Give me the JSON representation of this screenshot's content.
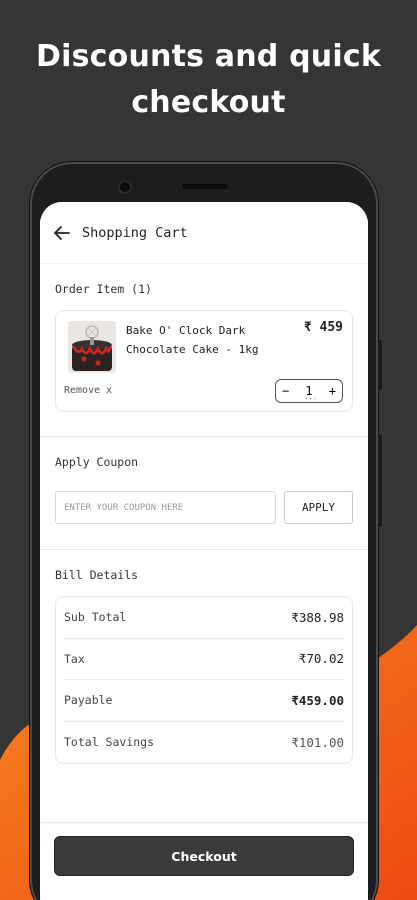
{
  "promo": {
    "headline_line1": "Discounts and quick",
    "headline_line2": "checkout"
  },
  "colors": {
    "background": "#353535",
    "accent_orange": "#f05a1a",
    "button_dark": "#3b3b3b"
  },
  "appbar": {
    "back_icon": "arrow-left-icon",
    "title": "Shopping Cart"
  },
  "order": {
    "section_title": "Order Item (1)",
    "item": {
      "name": "Bake O' Clock Dark Chocolate Cake - 1kg",
      "price": "₹ 459",
      "remove_label": "Remove x",
      "quantity": "1",
      "decrement_label": "−",
      "increment_label": "+"
    }
  },
  "coupon": {
    "section_title": "Apply Coupon",
    "placeholder": "ENTER YOUR COUPON HERE",
    "apply_label": "APPLY"
  },
  "bill": {
    "section_title": "Bill Details",
    "rows": [
      {
        "label": "Sub Total",
        "value": "₹388.98"
      },
      {
        "label": "Tax",
        "value": "₹70.02"
      },
      {
        "label": "Payable",
        "value": "₹459.00"
      },
      {
        "label": "Total Savings",
        "value": "₹101.00"
      }
    ]
  },
  "footer": {
    "checkout_label": "Checkout"
  }
}
